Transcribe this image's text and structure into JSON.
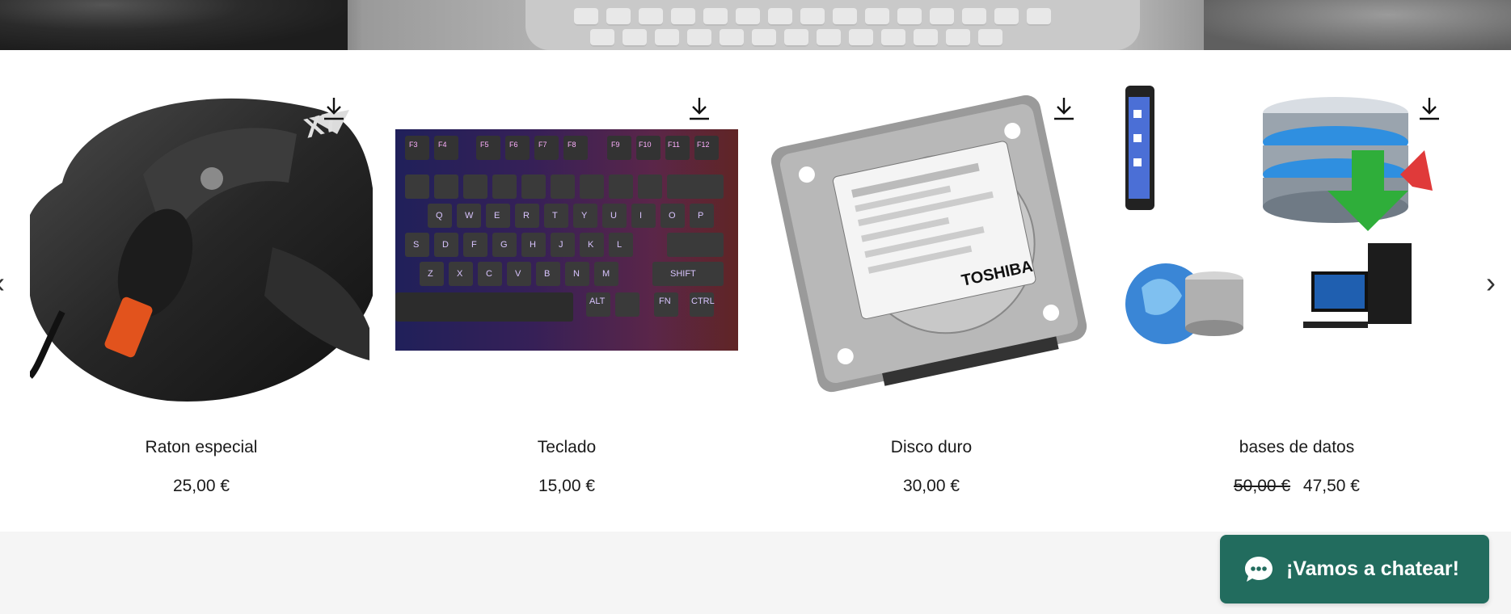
{
  "gallery": {
    "prev_icon": "chevron-left-icon",
    "next_icon": "chevron-right-icon",
    "prev_glyph": "‹",
    "next_glyph": "›",
    "products": [
      {
        "name": "Raton especial",
        "price": "25,00 €",
        "old_price": ""
      },
      {
        "name": "Teclado",
        "price": "15,00 €",
        "old_price": ""
      },
      {
        "name": "Disco duro",
        "price": "30,00 €",
        "old_price": ""
      },
      {
        "name": "bases de datos",
        "price": "47,50 €",
        "old_price": "50,00 €"
      }
    ]
  },
  "chat": {
    "label": "¡Vamos a chatear!",
    "icon": "chat-bubble-icon",
    "color": "#226c5e"
  },
  "keyboard_keys": {
    "row1": [
      "F3",
      "F4",
      "F5",
      "F6",
      "F7",
      "F8",
      "F9",
      "F10",
      "F11",
      "F12"
    ],
    "row3": [
      "Q",
      "W",
      "E",
      "R",
      "T",
      "Y",
      "U",
      "I",
      "O",
      "P"
    ],
    "row4": [
      "S",
      "D",
      "F",
      "G",
      "H",
      "J",
      "K",
      "L"
    ],
    "row5": [
      "Z",
      "X",
      "C",
      "V",
      "B",
      "N",
      "M"
    ],
    "shift": "SHIFT",
    "alt": "ALT",
    "fn": "FN",
    "ctrl": "CTRL"
  },
  "hdd_label": {
    "brand": "TOSHIBA"
  }
}
